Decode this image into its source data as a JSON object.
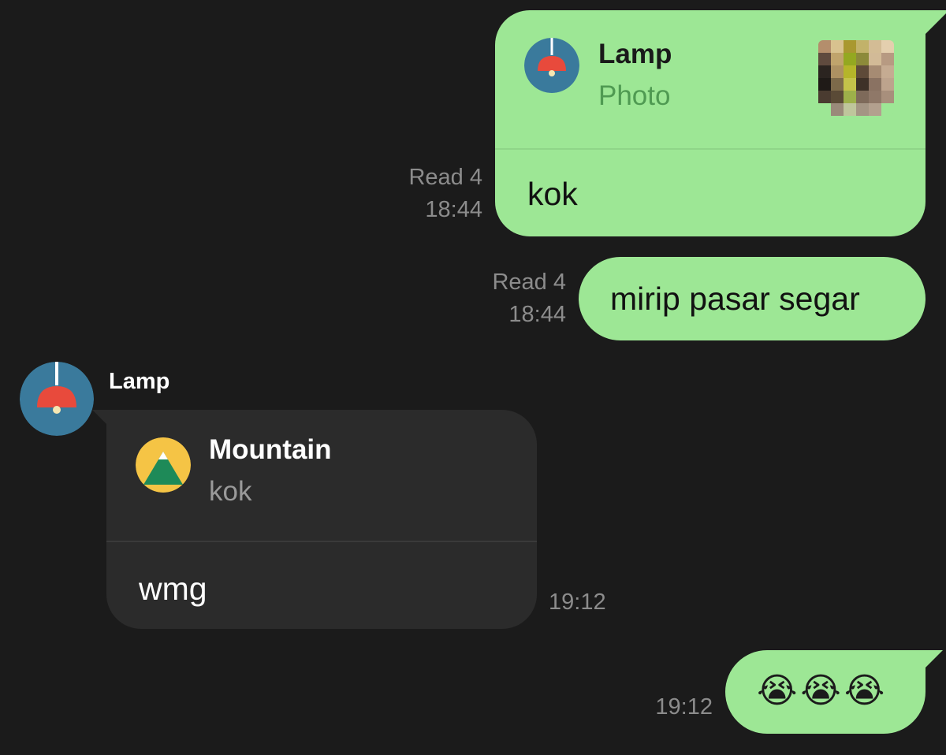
{
  "messages": [
    {
      "direction": "outgoing",
      "read_status": "Read 4",
      "time": "18:44",
      "quote": {
        "name": "Lamp",
        "type": "Photo",
        "icon": "lamp-icon"
      },
      "text": "kok"
    },
    {
      "direction": "outgoing",
      "read_status": "Read 4",
      "time": "18:44",
      "text": "mirip pasar segar"
    },
    {
      "direction": "incoming",
      "sender": "Lamp",
      "sender_avatar": "lamp-icon",
      "time": "19:12",
      "quote": {
        "name": "Mountain",
        "text": "kok",
        "icon": "mountain-icon"
      },
      "text": "wmg"
    },
    {
      "direction": "outgoing",
      "time": "19:12",
      "text": "😭😭😭"
    }
  ],
  "colors": {
    "background": "#1b1b1b",
    "outgoing_bubble": "#9de795",
    "incoming_bubble": "#2b2b2b",
    "quote_sub_green": "#4f9a52",
    "meta_text": "#8c8c8c"
  }
}
